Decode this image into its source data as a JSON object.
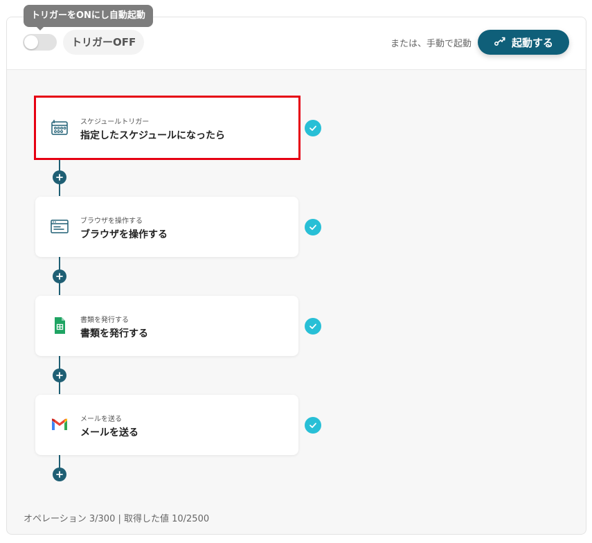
{
  "header": {
    "tooltip": "トリガーをONにし自動起動",
    "trigger_state": "トリガーOFF",
    "manual_text": "または、手動で起動",
    "start_button": "起動する"
  },
  "steps": [
    {
      "subtitle": "スケジュールトリガー",
      "title": "指定したスケジュールになったら",
      "icon": "calendar-schedule-icon",
      "selected": true
    },
    {
      "subtitle": "ブラウザを操作する",
      "title": "ブラウザを操作する",
      "icon": "browser-window-icon"
    },
    {
      "subtitle": "書類を発行する",
      "title": "書類を発行する",
      "icon": "google-sheets-icon"
    },
    {
      "subtitle": "メールを送る",
      "title": "メールを送る",
      "icon": "gmail-icon"
    }
  ],
  "footer": {
    "usage": "オペレーション 3/300 | 取得した値 10/2500"
  },
  "colors": {
    "primary": "#0f5f79",
    "check": "#28bfd6",
    "highlight": "#e60012",
    "connector": "#1f5f74"
  }
}
